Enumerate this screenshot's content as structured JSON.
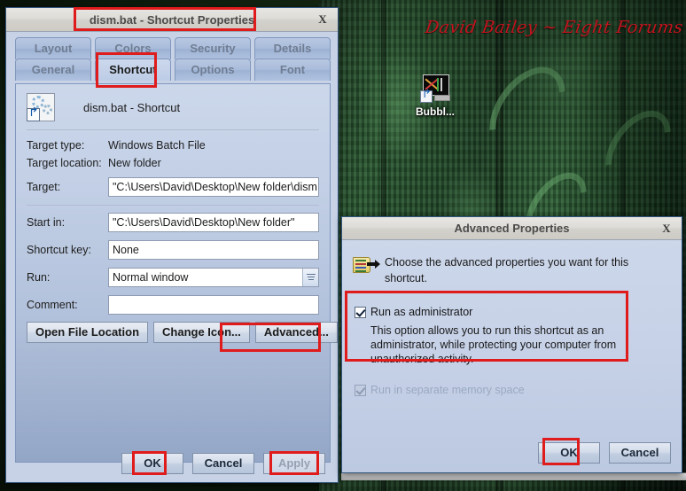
{
  "desktop": {
    "watermark": "David Bailey ~ Eight Forums",
    "icon": {
      "label": "Bubbl...",
      "icon_name": "bubble-shortcut-icon"
    }
  },
  "properties_window": {
    "title": "dism.bat - Shortcut Properties",
    "close_label": "X",
    "tabs_row1": [
      {
        "label": "Layout",
        "active": false
      },
      {
        "label": "Colors",
        "active": false
      },
      {
        "label": "Security",
        "active": false
      },
      {
        "label": "Details",
        "active": false
      }
    ],
    "tabs_row2": [
      {
        "label": "General",
        "active": false
      },
      {
        "label": "Shortcut",
        "active": true
      },
      {
        "label": "Options",
        "active": false
      },
      {
        "label": "Font",
        "active": false
      }
    ],
    "header": {
      "name": "dism.bat - Shortcut",
      "icon_name": "batch-file-shortcut-icon"
    },
    "fields": [
      {
        "label": "Target type:",
        "value": "Windows Batch File",
        "kind": "static"
      },
      {
        "label": "Target location:",
        "value": "New folder",
        "kind": "static"
      },
      {
        "label": "Target:",
        "value": "\"C:\\Users\\David\\Desktop\\New folder\\dism.bat\"",
        "kind": "input"
      },
      {
        "label": "Start in:",
        "value": "\"C:\\Users\\David\\Desktop\\New folder\"",
        "kind": "input"
      },
      {
        "label": "Shortcut key:",
        "value": "None",
        "kind": "input"
      },
      {
        "label": "Run:",
        "value": "Normal window",
        "kind": "combo"
      },
      {
        "label": "Comment:",
        "value": "",
        "kind": "input"
      }
    ],
    "action_buttons": [
      {
        "label": "Open File Location"
      },
      {
        "label": "Change Icon..."
      },
      {
        "label": "Advanced..."
      }
    ],
    "footer_buttons": [
      {
        "label": "OK",
        "disabled": false
      },
      {
        "label": "Cancel",
        "disabled": false
      },
      {
        "label": "Apply",
        "disabled": true
      }
    ]
  },
  "advanced_window": {
    "title": "Advanced Properties",
    "close_label": "X",
    "icon_name": "advanced-properties-icon",
    "description": "Choose the advanced properties you want for this shortcut.",
    "options": [
      {
        "label": "Run as administrator",
        "checked": true,
        "enabled": true,
        "description": "This option allows you to run this shortcut as an administrator, while protecting your computer from unauthorized activity."
      },
      {
        "label": "Run in separate memory space",
        "checked": true,
        "enabled": false,
        "description": ""
      }
    ],
    "footer_buttons": [
      {
        "label": "OK"
      },
      {
        "label": "Cancel"
      }
    ]
  },
  "annotations": {
    "color": "#e01b1b",
    "boxes": [
      {
        "name": "highlight-window-title"
      },
      {
        "name": "highlight-shortcut-tab"
      },
      {
        "name": "highlight-advanced-button"
      },
      {
        "name": "highlight-main-ok-button"
      },
      {
        "name": "highlight-apply-button"
      },
      {
        "name": "highlight-run-as-administrator"
      },
      {
        "name": "highlight-advanced-ok-button"
      }
    ]
  }
}
